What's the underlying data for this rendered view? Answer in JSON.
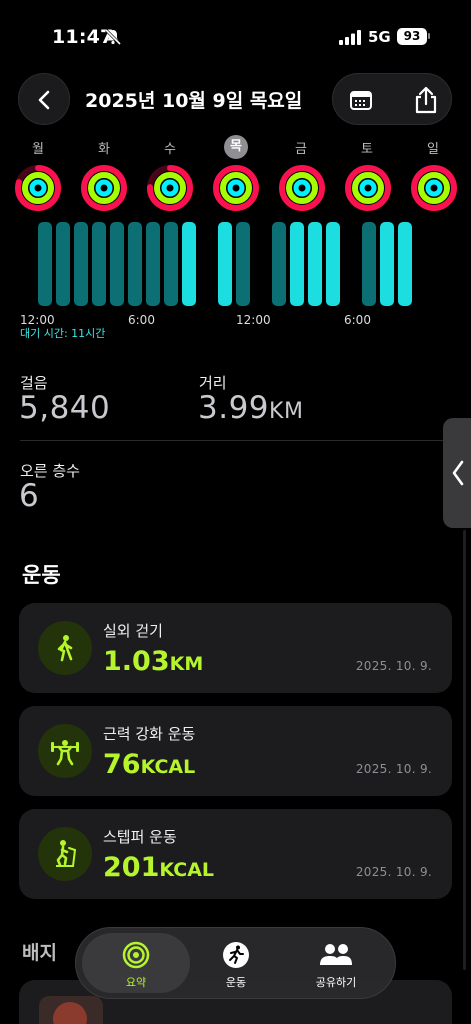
{
  "status_bar": {
    "time": "11:47",
    "network": "5G",
    "battery": "93"
  },
  "header": {
    "title": "2025년 10월 9일 목요일"
  },
  "week": {
    "days": [
      "월",
      "화",
      "수",
      "목",
      "금",
      "토",
      "일"
    ],
    "selected_index": 3
  },
  "activity_timeline": {
    "ticks": [
      "12:00",
      "6:00",
      "12:00",
      "6:00"
    ],
    "standby": "대기 시간: 11시간"
  },
  "metrics": {
    "steps": {
      "label": "걸음",
      "value": "5,840"
    },
    "distance": {
      "label": "거리",
      "value": "3.99",
      "unit": "KM"
    },
    "floors": {
      "label": "오른 층수",
      "value": "6"
    }
  },
  "workouts": {
    "title": "운동",
    "items": [
      {
        "name": "실외 걷기",
        "value": "1.03",
        "unit": "KM",
        "date": "2025. 10. 9.",
        "icon": "walking-icon"
      },
      {
        "name": "근력 강화 운동",
        "value": "76",
        "unit": "KCAL",
        "date": "2025. 10. 9.",
        "icon": "strength-icon"
      },
      {
        "name": "스텝퍼 운동",
        "value": "201",
        "unit": "KCAL",
        "date": "2025. 10. 9.",
        "icon": "stair-stepper-icon"
      }
    ]
  },
  "badges": {
    "title": "배지"
  },
  "tabbar": {
    "tabs": [
      {
        "label": "요약",
        "icon": "rings-icon",
        "active": true
      },
      {
        "label": "운동",
        "icon": "running-icon",
        "active": false
      },
      {
        "label": "공유하기",
        "icon": "people-icon",
        "active": false
      }
    ]
  },
  "colors": {
    "move": "#fa114f",
    "exercise": "#a6ff00",
    "stand": "#00f0ff",
    "accent": "#b6f52c"
  }
}
